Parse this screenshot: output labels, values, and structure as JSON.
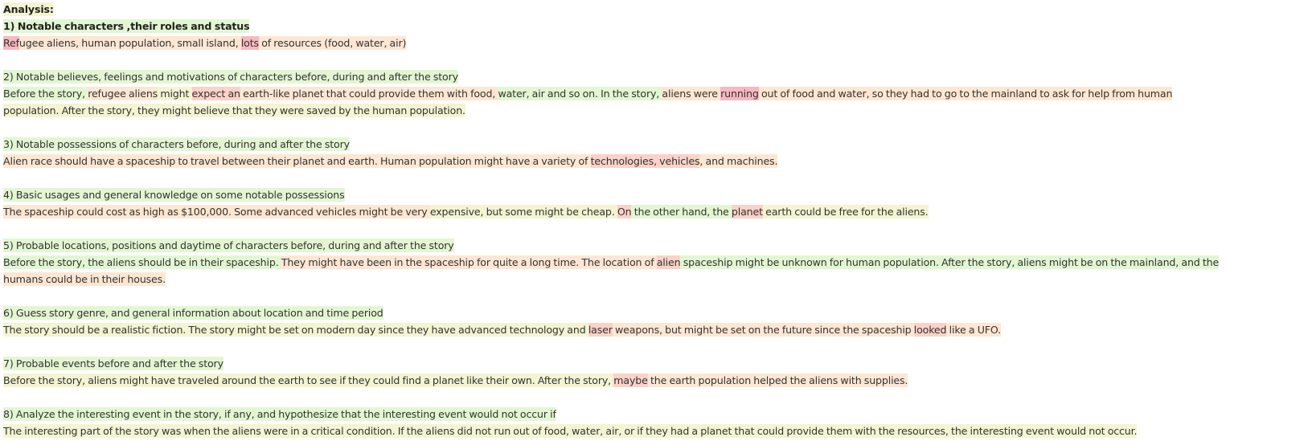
{
  "analysis": {
    "title": "Analysis:",
    "lines": [
      {
        "bold": true,
        "tokens": [
          [
            "1) Notable characters ,their roles and status",
            "g1"
          ]
        ]
      },
      {
        "tokens": [
          [
            "Ref",
            "r"
          ],
          [
            "ugee aliens, human population, small island, ",
            "o1"
          ],
          [
            "lots",
            "r"
          ],
          [
            " of resources (food, water, air)",
            "o1"
          ]
        ]
      },
      {
        "blank": true,
        "tokens": []
      },
      {
        "tokens": [
          [
            "2) Notable believes, feelings and motivations of characters before, during and after the story",
            "g1"
          ]
        ]
      },
      {
        "tokens": [
          [
            "Before the story, ",
            "g1"
          ],
          [
            "refugee aliens",
            "o1"
          ],
          [
            " might ",
            "y"
          ],
          [
            "expect an",
            "o2"
          ],
          [
            " earth-like planet that could provide them with food, ",
            "o1"
          ],
          [
            "water, air and so on. In the story, ",
            "g1"
          ],
          [
            "aliens were ",
            "o1"
          ],
          [
            "running",
            "r"
          ],
          [
            " out of food and water, so they had to go to the mainland to ask for help from human",
            "o1"
          ]
        ]
      },
      {
        "tokens": [
          [
            "population. After the story, they might believe that they were saved by the human population.",
            "y"
          ]
        ]
      },
      {
        "blank": true,
        "tokens": []
      },
      {
        "tokens": [
          [
            "3) Notable possessions of characters before, during and after the story",
            "g1"
          ]
        ]
      },
      {
        "tokens": [
          [
            "Alien race should have a spaceship to travel between their planet and earth. Human population might have a variety of ",
            "o1"
          ],
          [
            "technologies, vehicles",
            "o2"
          ],
          [
            ", and machines.",
            "o1"
          ]
        ]
      },
      {
        "blank": true,
        "tokens": []
      },
      {
        "tokens": [
          [
            "4) Basic usages and general knowledge on some notable possessions",
            "g1"
          ]
        ]
      },
      {
        "tokens": [
          [
            "The spaceship could cost as high as $100,000. Some advanced vehicles might be very ",
            "o1"
          ],
          [
            "expensive, but some might be cheap. ",
            "y"
          ],
          [
            "On",
            "o2"
          ],
          [
            " the other hand, the ",
            "g1"
          ],
          [
            "planet",
            "o2"
          ],
          [
            " earth could be free for the aliens.",
            "y"
          ]
        ]
      },
      {
        "blank": true,
        "tokens": []
      },
      {
        "tokens": [
          [
            "5) Probable locations, positions and daytime of characters before, during and after the story",
            "g1"
          ]
        ]
      },
      {
        "tokens": [
          [
            "Before the story, the aliens should be in their spaceship. ",
            "g1"
          ],
          [
            "They might have been in the spaceship for quite a long time. The location of ",
            "o1"
          ],
          [
            "alien",
            "o2"
          ],
          [
            " spaceship might be unknown for human population. After the story, aliens might be on the mainland, and the",
            "g1"
          ]
        ]
      },
      {
        "tokens": [
          [
            "humans could be in their houses.",
            "o1"
          ]
        ]
      },
      {
        "blank": true,
        "tokens": []
      },
      {
        "tokens": [
          [
            "6) Guess story genre, and general information about location and time period",
            "g1"
          ]
        ]
      },
      {
        "tokens": [
          [
            "The story should be a realistic fiction. The story might be set on modern day since they have advanced technology and ",
            "y"
          ],
          [
            "laser",
            "o2"
          ],
          [
            " weapons, but might be set on the future since the spaceship ",
            "o1"
          ],
          [
            "looked",
            "o2"
          ],
          [
            " like a UFO.",
            "o1"
          ]
        ]
      },
      {
        "blank": true,
        "tokens": []
      },
      {
        "tokens": [
          [
            "7) Probable events before and after the story",
            "g1"
          ]
        ]
      },
      {
        "tokens": [
          [
            "Before the story, aliens might have traveled around the earth to see if they could find a planet like their own. After the story, ",
            "y"
          ],
          [
            "maybe",
            "o2"
          ],
          [
            " the earth population helped the aliens with supplies.",
            "o1"
          ]
        ]
      },
      {
        "blank": true,
        "tokens": []
      },
      {
        "tokens": [
          [
            "8) Analyze the interesting event in the story, if any, and hypothesize that the interesting event would not occur if",
            "g1"
          ]
        ]
      },
      {
        "tokens": [
          [
            "The interesting part of the story was when the aliens were in a critical condition. If the aliens did not run out of food, water, air, or if they had a planet that could provide them with the resources, the interesting event would not occur.",
            "y"
          ]
        ]
      }
    ]
  }
}
